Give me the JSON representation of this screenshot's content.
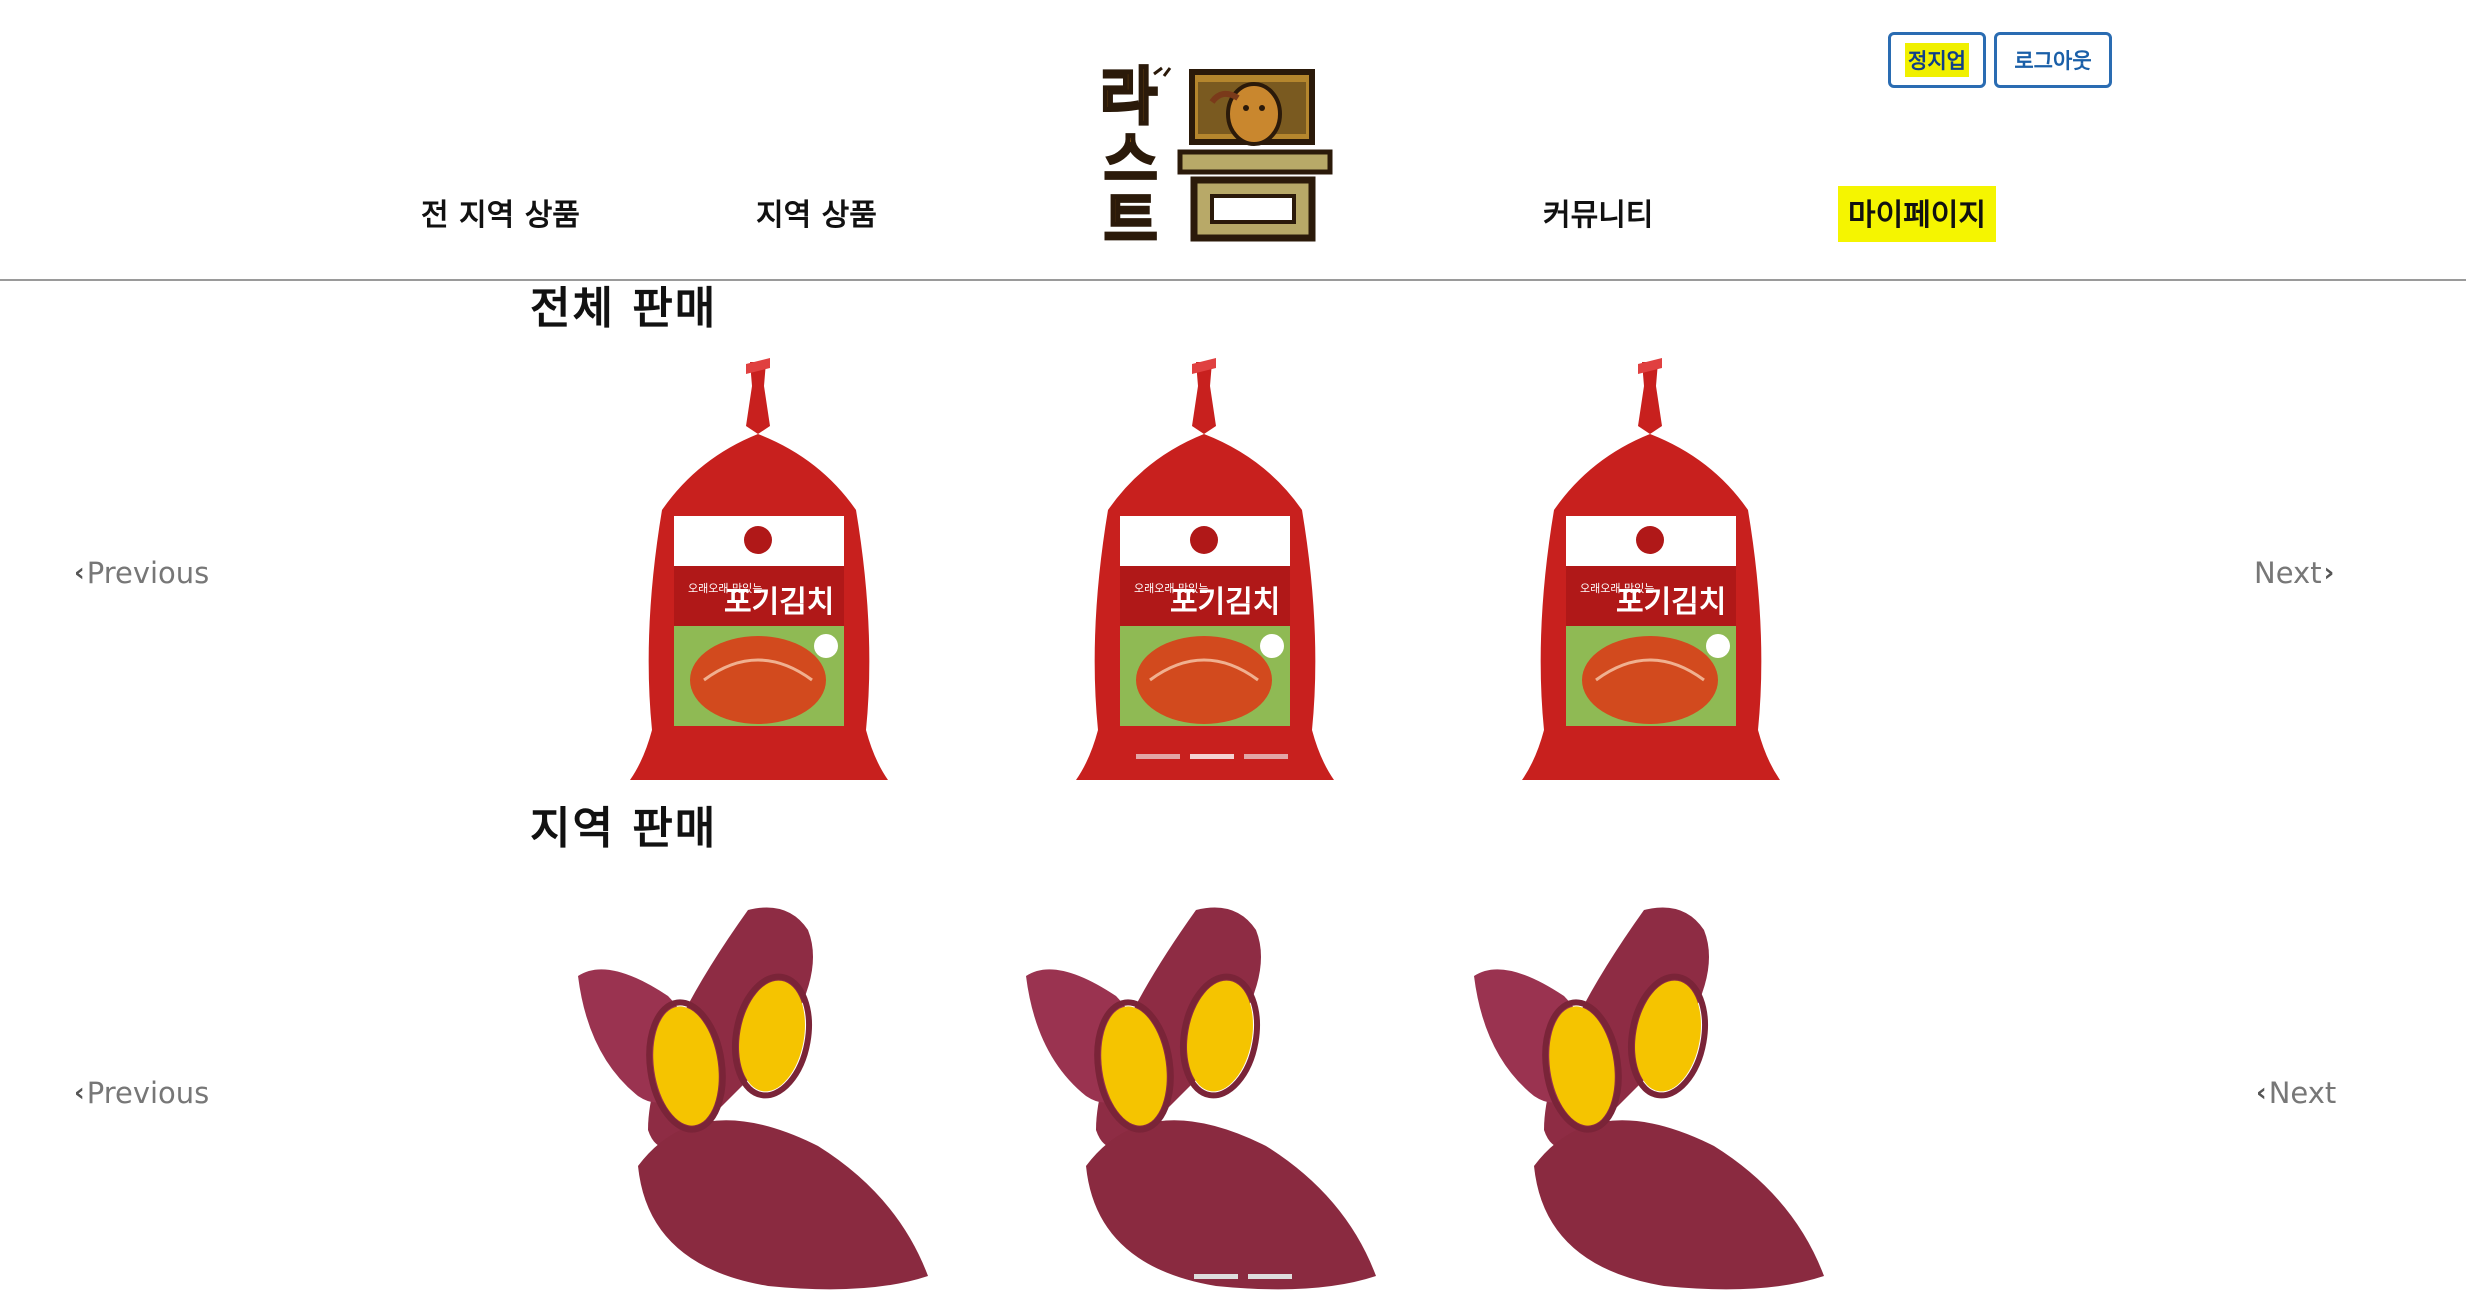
{
  "header": {
    "user_button_label": "정지업",
    "logout_button_label": "로그아웃",
    "nav": {
      "all_products": "전 지역 상품",
      "region_products": "지역 상품",
      "community": "커뮤니티",
      "mypage": "마이페이지"
    },
    "logo_text": "라스트팜"
  },
  "sections": [
    {
      "title": "전체 판매",
      "prev_label": "Previous",
      "next_label": "Next",
      "product_label_small": "오래오래 맛있는",
      "product_label_big": "포기김치",
      "active_indicator": 2,
      "indicator_count": 3
    },
    {
      "title": "지역 판매",
      "prev_label": "Previous",
      "next_label": "Next"
    }
  ],
  "colors": {
    "highlight": "#f5f500",
    "button_border": "#2a6cb2",
    "kimchi_red": "#c8201e",
    "sweet_potato": "#8e2c44",
    "potato_flesh": "#f5c400"
  }
}
